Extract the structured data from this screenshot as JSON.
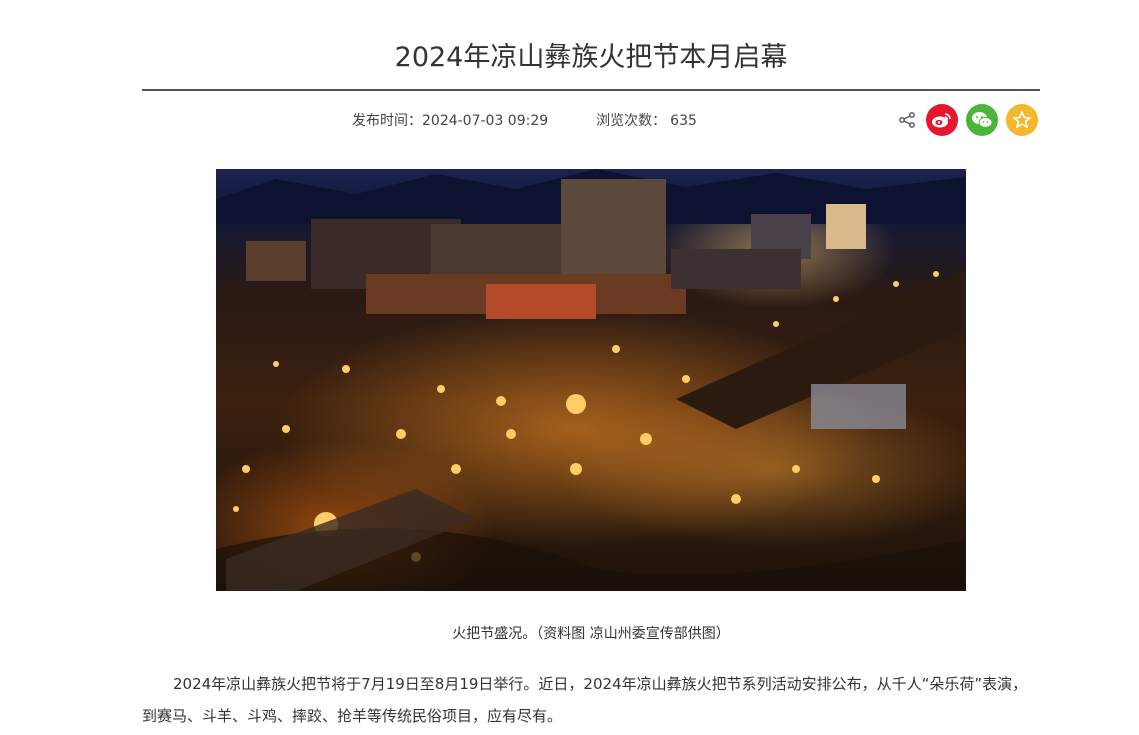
{
  "article": {
    "title": "2024年凉山彝族火把节本月启幕",
    "publish_label": "发布时间：",
    "publish_time": "2024-07-03 09:29",
    "views_label": "浏览次数：",
    "views_count": "635",
    "image_alt": "火把节盛况",
    "caption": "火把节盛况。（资料图 凉山州委宣传部供图）",
    "paragraph": "2024年凉山彝族火把节将于7月19日至8月19日举行。近日，2024年凉山彝族火把节系列活动安排公布，从千人“朵乐荷”表演，到赛马、斗羊、斗鸡、摔跤、抢羊等传统民俗项目，应有尽有。"
  },
  "share": {
    "icons": [
      "share-icon",
      "weibo-icon",
      "wechat-icon",
      "favorite-icon"
    ],
    "colors": {
      "weibo": "#e6162d",
      "wechat": "#4bb43a",
      "favorite": "#f5b62d"
    }
  }
}
